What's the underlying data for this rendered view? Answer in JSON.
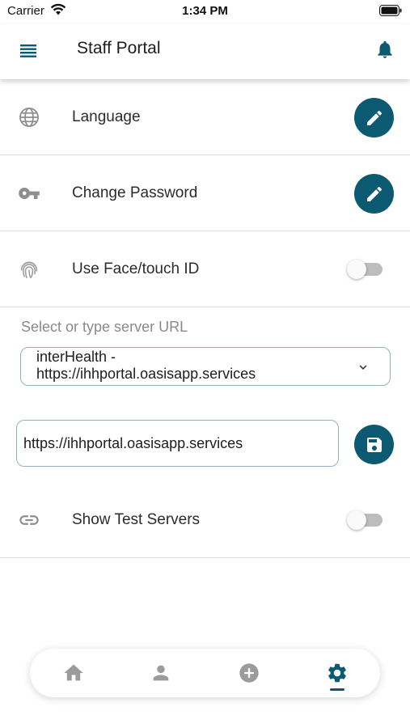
{
  "status_bar": {
    "carrier": "Carrier",
    "time": "1:34 PM"
  },
  "header": {
    "title": "Staff Portal",
    "menu_icon": "menu-icon",
    "notification_icon": "bell-icon"
  },
  "settings": [
    {
      "label": "Language",
      "icon": "globe-icon",
      "action": "edit"
    },
    {
      "label": "Change Password",
      "icon": "key-icon",
      "action": "edit"
    },
    {
      "label": "Use Face/touch ID",
      "icon": "fingerprint-icon",
      "action": "toggle",
      "enabled": false
    }
  ],
  "server": {
    "label": "Select or type server URL",
    "selected_line1": "interHealth -",
    "selected_line2": "https://ihhportal.oasisapp.services",
    "url_value": "https://ihhportal.oasisapp.services"
  },
  "test_servers": {
    "label": "Show Test Servers",
    "icon": "link-icon",
    "enabled": false
  },
  "bottom_nav": {
    "items": [
      "home-icon",
      "person-icon",
      "add-circle-icon",
      "settings-gear-icon"
    ],
    "active": "settings-gear-icon"
  },
  "colors": {
    "accent": "#0c5a71",
    "icon_grey": "#8e8e8e",
    "divider": "#dcdcdc",
    "toggle_off": "#bdbdbd"
  }
}
